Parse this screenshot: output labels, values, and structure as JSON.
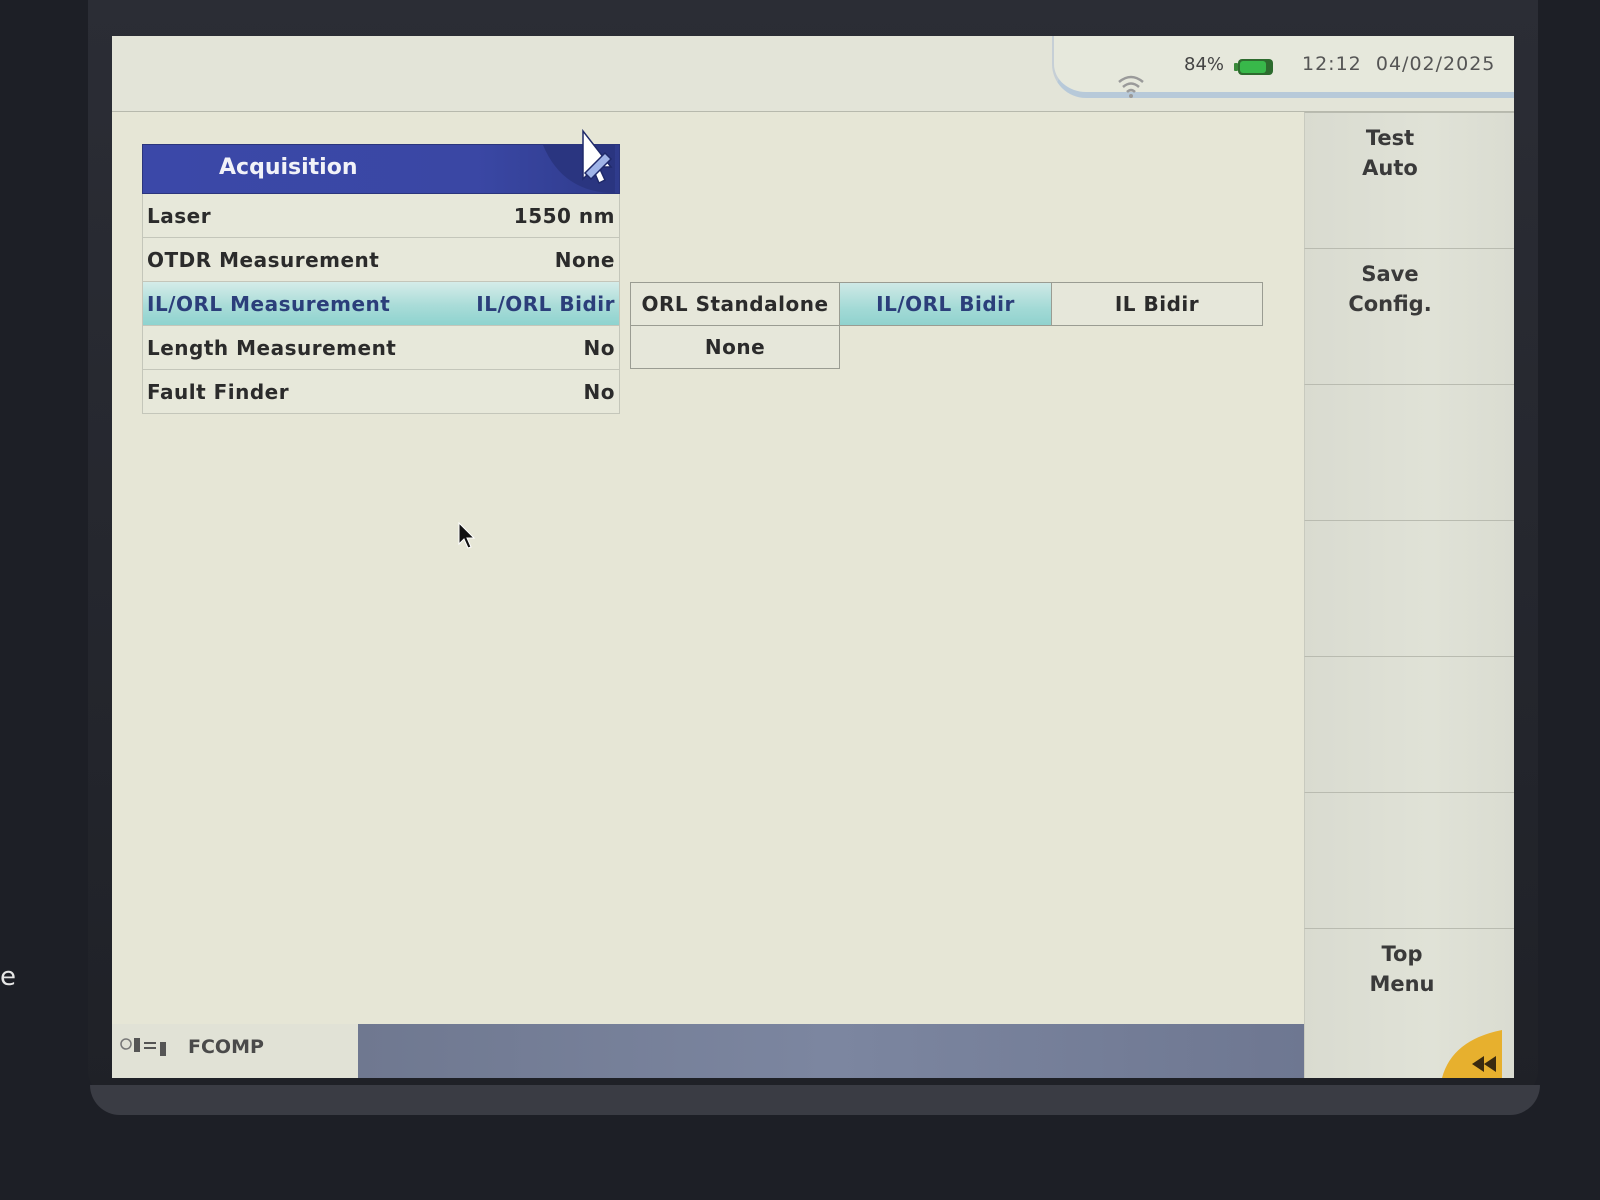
{
  "device": {
    "side_letter": "e"
  },
  "status": {
    "battery_percent": "84%",
    "time": "12:12",
    "date": "04/02/2025",
    "icons": [
      "wifi-icon",
      "battery-icon"
    ],
    "battery_level": 0.84,
    "battery_color": "#38b84a"
  },
  "acquisition": {
    "title": "Acquisition",
    "header_icon": "edit-settings-icon",
    "header_color": "#3b48a8",
    "rows": [
      {
        "label": "Laser",
        "value": "1550 nm"
      },
      {
        "label": "OTDR Measurement",
        "value": "None"
      },
      {
        "label": "IL/ORL Measurement",
        "value": "IL/ORL Bidir",
        "selected": true
      },
      {
        "label": "Length Measurement",
        "value": "No"
      },
      {
        "label": "Fault Finder",
        "value": "No"
      }
    ]
  },
  "options": {
    "row1": [
      "ORL Standalone",
      "IL/ORL Bidir",
      "IL Bidir"
    ],
    "row2": [
      "None"
    ],
    "active": "IL/ORL Bidir",
    "active_color": "#a3dad6"
  },
  "softkeys": [
    {
      "label": "Test\nAuto"
    },
    {
      "label": "Save\nConfig."
    },
    {
      "label": ""
    },
    {
      "label": ""
    },
    {
      "label": ""
    },
    {
      "label": ""
    },
    {
      "label": "Top\nMenu"
    }
  ],
  "bottom": {
    "profile_name": "FCOMP",
    "icons": [
      "fiber-connection-icon",
      "back-arrow-icon"
    ]
  }
}
